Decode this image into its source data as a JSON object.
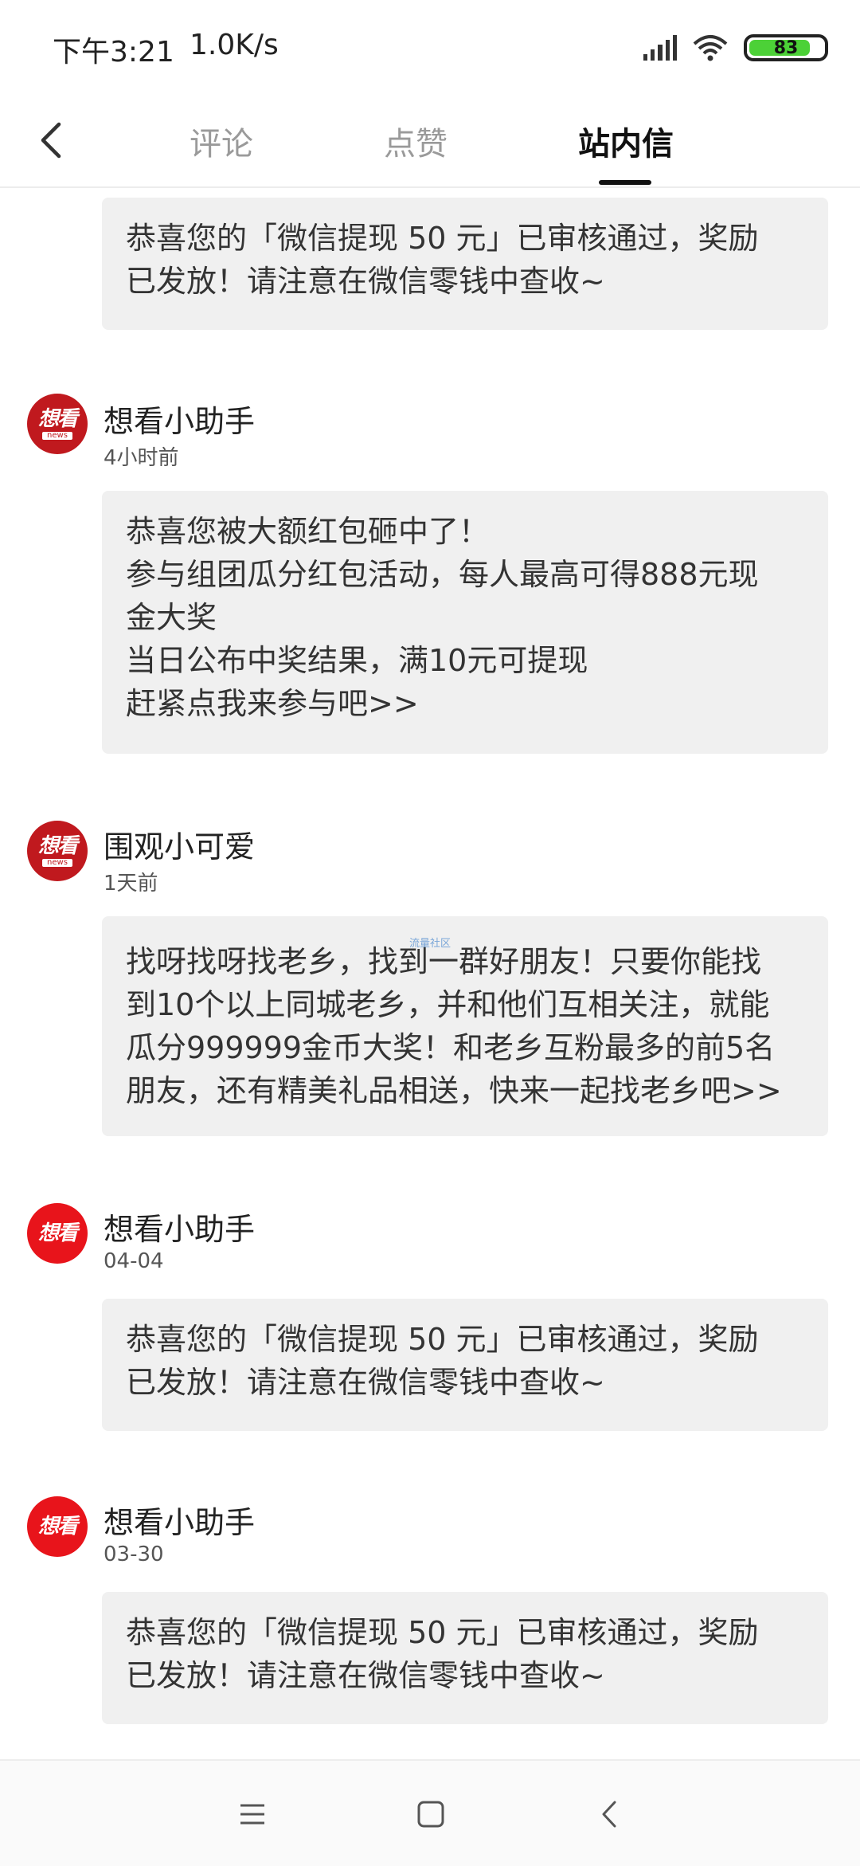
{
  "status_bar": {
    "time": "下午3:21",
    "network_speed": "1.0K/s",
    "battery": "83",
    "battery_level": 0.83,
    "battery_color": "#4cd137"
  },
  "header": {
    "tabs": [
      {
        "label": "评论",
        "active": false
      },
      {
        "label": "点赞",
        "active": false
      },
      {
        "label": "站内信",
        "active": true
      }
    ]
  },
  "messages": [
    {
      "partial": true,
      "body": [
        "恭喜您的「微信提现 50 元」已审核通过，奖励",
        "已发放！请注意在微信零钱中查收~"
      ]
    },
    {
      "sender": "想看小助手",
      "time": "4小时前",
      "avatar_style": "dark",
      "body": [
        "恭喜您被大额红包砸中了！",
        "参与组团瓜分红包活动，每人最高可得888元现",
        "金大奖",
        "当日公布中奖结果，满10元可提现",
        "赶紧点我来参与吧>>"
      ]
    },
    {
      "sender": "围观小可爱",
      "time": "1天前",
      "avatar_style": "dark",
      "body": [
        "找呀找呀找老乡，找到一群好朋友！只要你能找",
        "到10个以上同城老乡，并和他们互相关注，就能",
        "瓜分999999金币大奖！和老乡互粉最多的前5名",
        "朋友，还有精美礼品相送，快来一起找老乡吧>>"
      ]
    },
    {
      "sender": "想看小助手",
      "time": "04-04",
      "avatar_style": "red",
      "body": [
        "恭喜您的「微信提现 50 元」已审核通过，奖励",
        "已发放！请注意在微信零钱中查收~"
      ]
    },
    {
      "sender": "想看小助手",
      "time": "03-30",
      "avatar_style": "red",
      "body": [
        "恭喜您的「微信提现 50 元」已审核通过，奖励",
        "已发放！请注意在微信零钱中查收~"
      ]
    }
  ],
  "avatar": {
    "logo_text": "想看",
    "logo_sub": "news"
  },
  "watermark": "流量社区",
  "colors": {
    "brand_red": "#e8141b",
    "bubble_bg": "#f0f0f0"
  }
}
